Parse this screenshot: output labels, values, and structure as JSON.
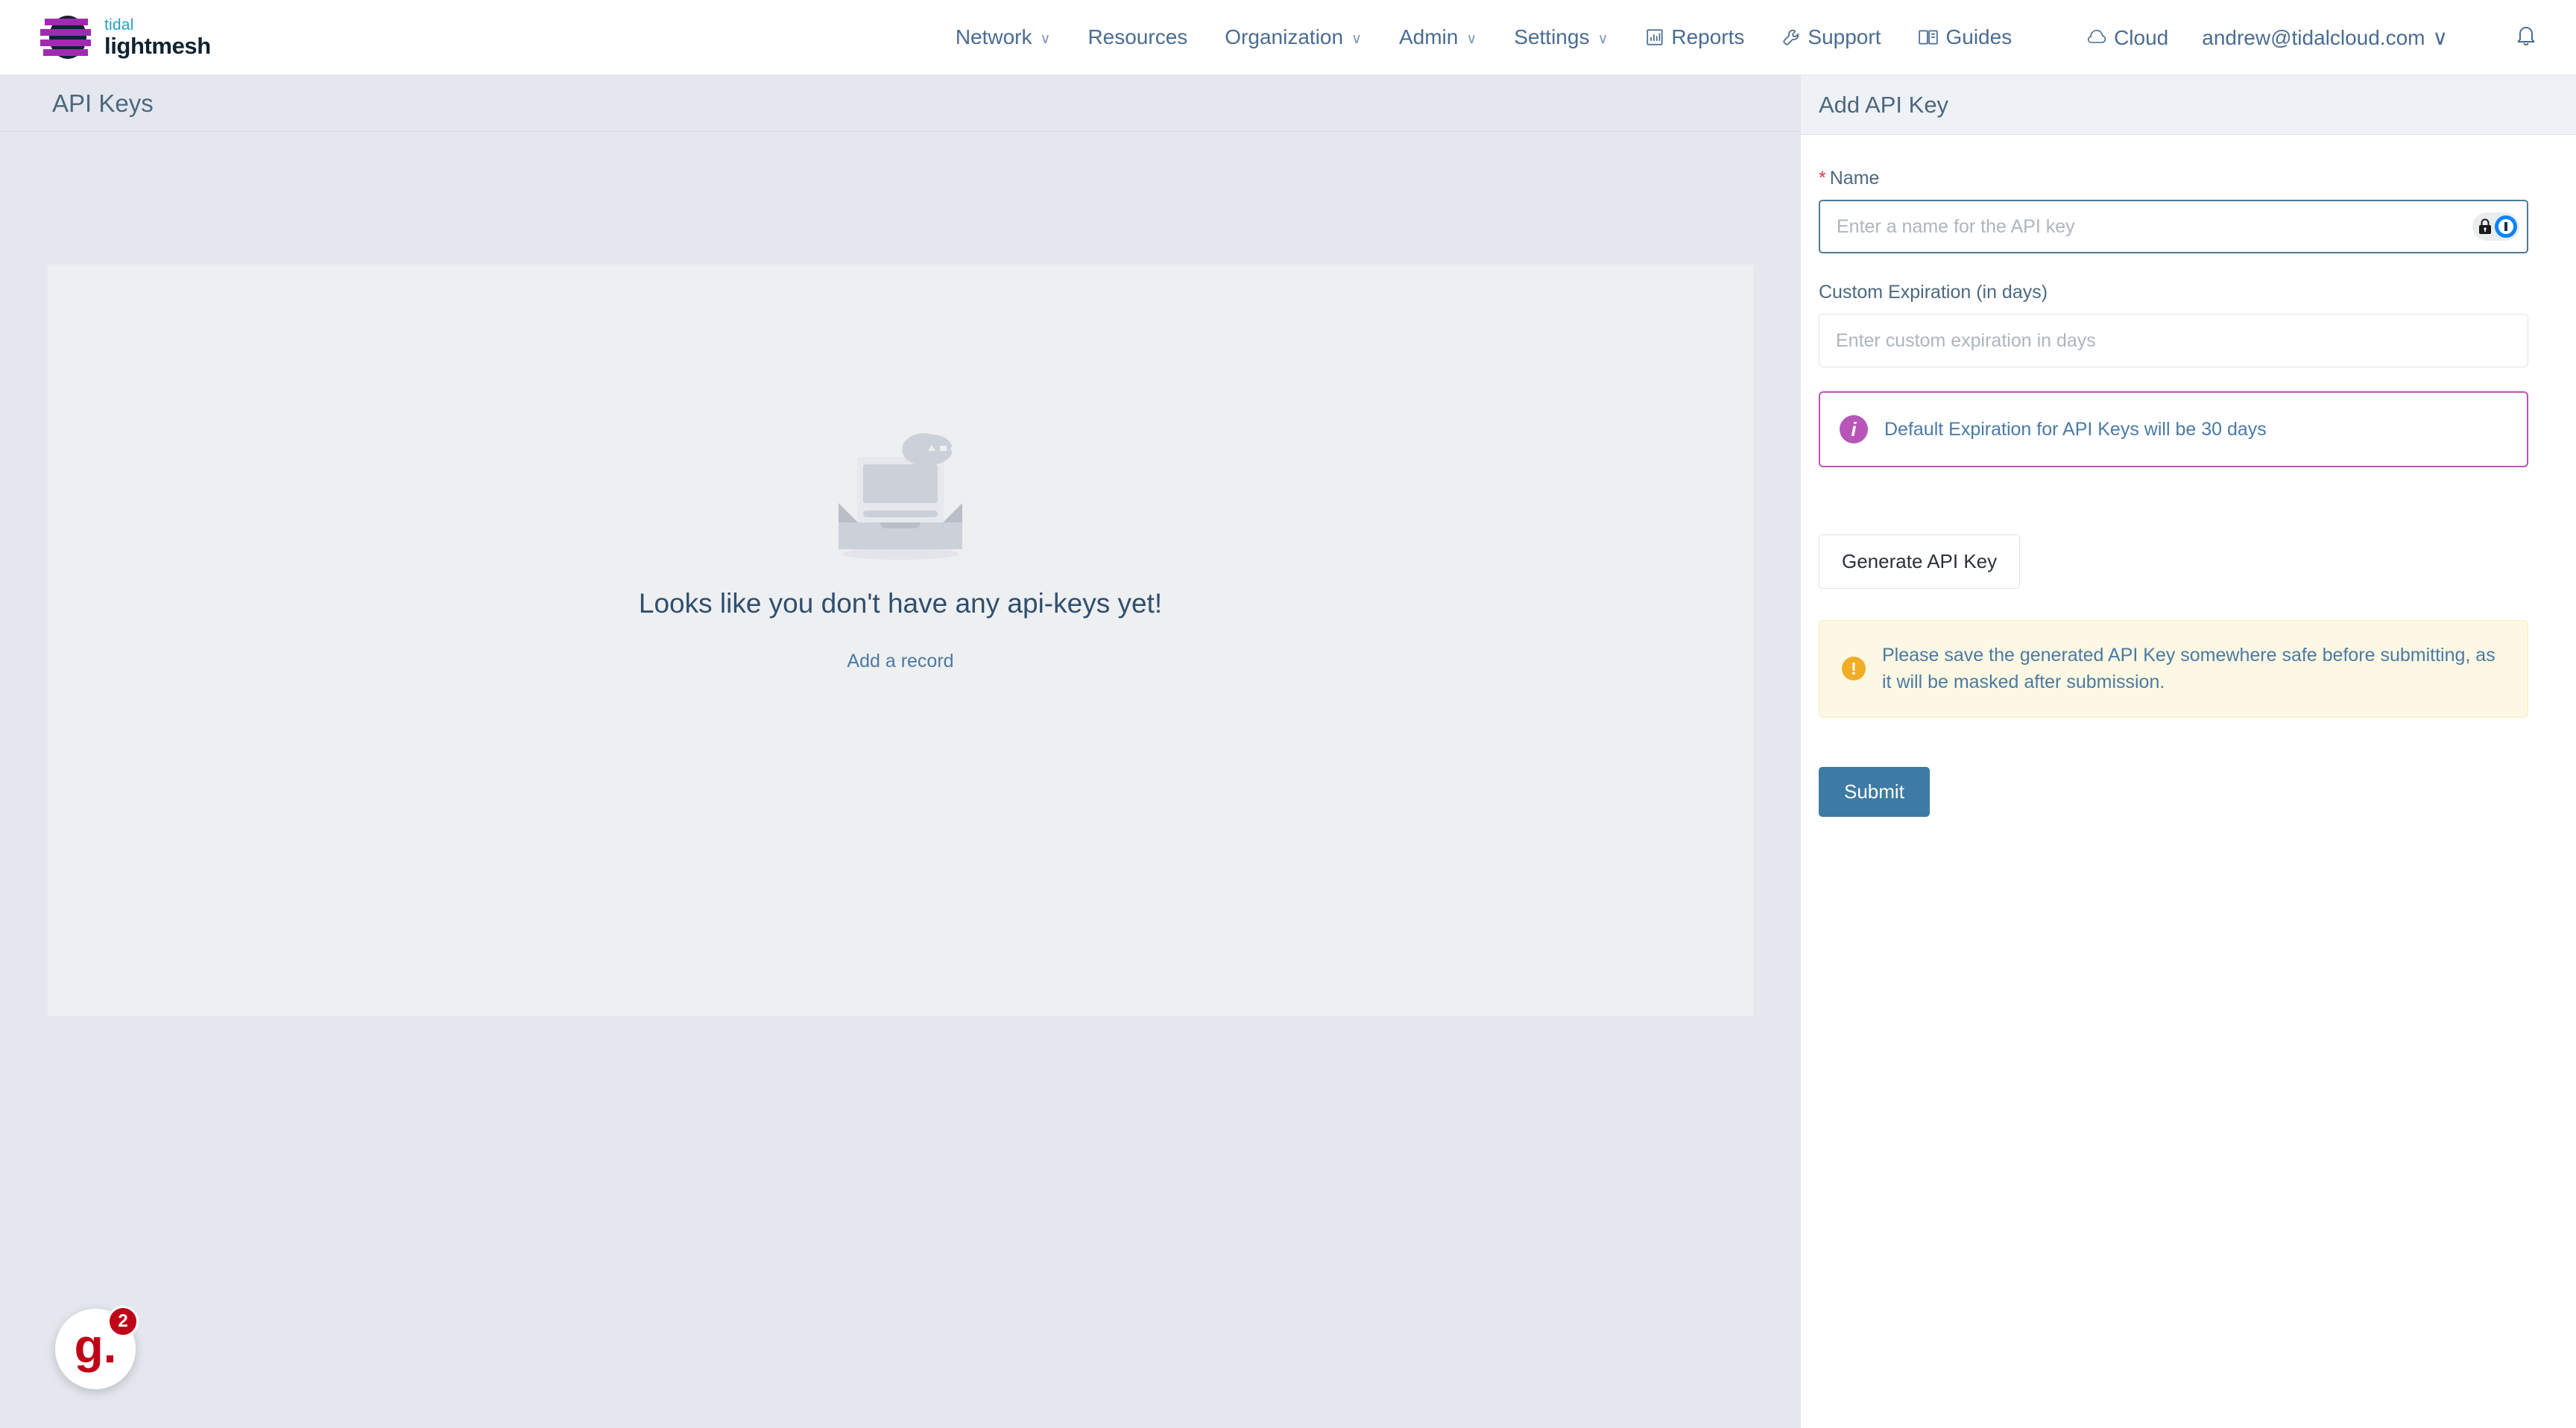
{
  "brand": {
    "top_word": "tidal",
    "bottom_word": "lightmesh",
    "logo_icon": "lightmesh-logo-icon"
  },
  "nav": {
    "items": [
      {
        "label": "Network",
        "has_caret": true,
        "icon": null
      },
      {
        "label": "Resources",
        "has_caret": false,
        "icon": null
      },
      {
        "label": "Organization",
        "has_caret": true,
        "icon": null
      },
      {
        "label": "Admin",
        "has_caret": true,
        "icon": null
      },
      {
        "label": "Settings",
        "has_caret": true,
        "icon": null
      },
      {
        "label": "Reports",
        "has_caret": false,
        "icon": "bar-chart-icon"
      },
      {
        "label": "Support",
        "has_caret": false,
        "icon": "wrench-icon"
      },
      {
        "label": "Guides",
        "has_caret": false,
        "icon": "book-icon"
      }
    ],
    "cloud_label": "Cloud",
    "cloud_icon": "cloud-icon",
    "user_email": "andrew@tidalcloud.com",
    "user_caret": "∨",
    "notification_icon": "bell-icon"
  },
  "page": {
    "title": "API Keys"
  },
  "empty_state": {
    "illustration": "empty-inbox-illustration",
    "title": "Looks like you don't have any api-keys yet!",
    "link_label": "Add a record"
  },
  "panel": {
    "title": "Add API Key",
    "name_field": {
      "label": "Name",
      "required_marker": "*",
      "value": "",
      "placeholder": "Enter a name for the API key",
      "password_manager_icon": "lock-icon"
    },
    "expiration_field": {
      "label": "Custom Expiration (in days)",
      "value": "",
      "placeholder": "Enter custom expiration in days"
    },
    "info_note": {
      "icon": "info-icon",
      "text": "Default Expiration for API Keys will be 30 days",
      "border_color": "#b855b8"
    },
    "generate_button": "Generate API Key",
    "warning": {
      "icon": "warning-icon",
      "text": "Please save the generated API Key somewhere safe before submitting, as it will be masked after submission.",
      "background": "#fcf8e3"
    },
    "submit_button": "Submit",
    "submit_color": "#3d7ba5"
  },
  "chat_widget": {
    "logo_text": "g.",
    "badge_count": "2",
    "color": "#c00418"
  }
}
